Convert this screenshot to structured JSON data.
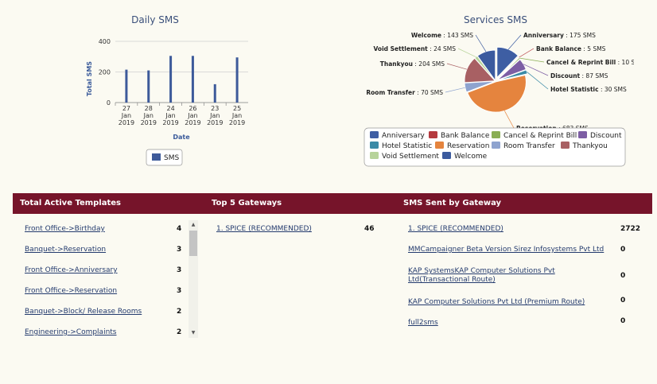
{
  "daily_chart": {
    "chart_data": {
      "type": "bar",
      "title": "Daily SMS",
      "xlabel": "Date",
      "ylabel": "Total SMS",
      "ylim": [
        0,
        400
      ],
      "yticks": [
        0,
        200,
        400
      ],
      "categories": [
        [
          "27",
          "Jan",
          "2019"
        ],
        [
          "28",
          "Jan",
          "2019"
        ],
        [
          "24",
          "Jan",
          "2019"
        ],
        [
          "26",
          "Jan",
          "2019"
        ],
        [
          "23",
          "Jan",
          "2019"
        ],
        [
          "25",
          "Jan",
          "2019"
        ]
      ],
      "series": [
        {
          "name": "SMS",
          "values": [
            215,
            210,
            305,
            305,
            120,
            295
          ]
        }
      ],
      "legend": "bottom",
      "grid": true,
      "color": "#3d5a9a"
    }
  },
  "services_chart": {
    "chart_data": {
      "type": "pie",
      "title": "Services SMS",
      "unit": "SMS",
      "slices": [
        {
          "label": "Anniversary",
          "value": 175,
          "color": "#3e5ea3"
        },
        {
          "label": "Bank Balance",
          "value": 5,
          "color": "#b53a3f"
        },
        {
          "label": "Cancel & Reprint Bill",
          "value": 10,
          "color": "#8aae54"
        },
        {
          "label": "Discount",
          "value": 87,
          "color": "#7d5ea4"
        },
        {
          "label": "Hotel Statistic",
          "value": 30,
          "color": "#3a8aa6"
        },
        {
          "label": "Reservation",
          "value": 683,
          "color": "#e5843e"
        },
        {
          "label": "Room Transfer",
          "value": 70,
          "color": "#8ea3cf"
        },
        {
          "label": "Thankyou",
          "value": 204,
          "color": "#a86063"
        },
        {
          "label": "Void Settlement",
          "value": 24,
          "color": "#b7d39a"
        },
        {
          "label": "Welcome",
          "value": 143,
          "color": "#3b5a9e"
        }
      ],
      "legend": "bottom"
    }
  },
  "sections": {
    "templates_title": "Total Active Templates",
    "gateways_title": "Top 5 Gateways",
    "sent_title": "SMS Sent by Gateway"
  },
  "templates": [
    {
      "name": "Front Office->Birthday",
      "count": "4"
    },
    {
      "name": "Banquet->Reservation",
      "count": "3"
    },
    {
      "name": "Front Office->Anniversary",
      "count": "3"
    },
    {
      "name": "Front Office->Reservation",
      "count": "3"
    },
    {
      "name": "Banquet->Block/ Release Rooms",
      "count": "2"
    },
    {
      "name": "Engineering->Complaints",
      "count": "2"
    }
  ],
  "top_gateways": [
    {
      "name": "1. SPICE (RECOMMENDED)",
      "count": "46"
    }
  ],
  "sent_by_gateway": [
    {
      "name": "1. SPICE (RECOMMENDED)",
      "count": "2722"
    },
    {
      "name": "MMCampaigner Beta Version Sirez Infosystems Pvt Ltd",
      "count": "0"
    },
    {
      "name": "KAP SystemsKAP Computer Solutions Pvt Ltd(Transactional Route)",
      "count": "0"
    },
    {
      "name": "KAP Computer Solutions Pvt Ltd (Premium Route)",
      "count": "0"
    },
    {
      "name": "full2sms",
      "count": "0"
    }
  ],
  "scrollbar": {
    "up_icon": "▲",
    "down_icon": "▼"
  }
}
